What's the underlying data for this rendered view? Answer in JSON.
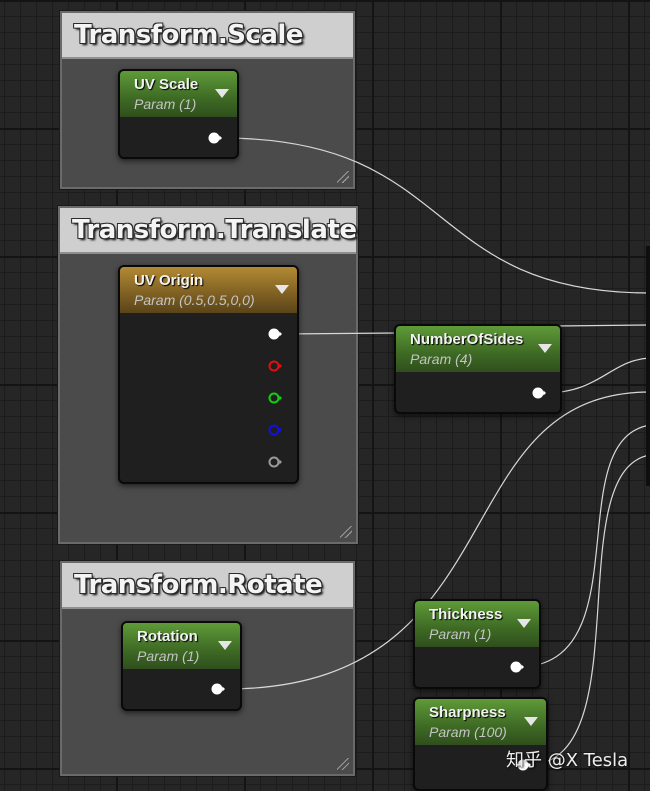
{
  "comments": [
    {
      "id": "scale",
      "title": "Transform.Scale"
    },
    {
      "id": "translate",
      "title": "Transform.Translate"
    },
    {
      "id": "rotate",
      "title": "Transform.Rotate"
    }
  ],
  "nodes": {
    "uv_scale": {
      "title": "UV Scale",
      "subtitle": "Param (1)",
      "color": "#5a9434"
    },
    "uv_origin": {
      "title": "UV Origin",
      "subtitle": "Param (0.5,0.5,0,0)",
      "color": "#a8822f"
    },
    "number_of_sides": {
      "title": "NumberOfSides",
      "subtitle": "Param (4)",
      "color": "#5a9434"
    },
    "rotation": {
      "title": "Rotation",
      "subtitle": "Param (1)",
      "color": "#5a9434"
    },
    "thickness": {
      "title": "Thickness",
      "subtitle": "Param (1)",
      "color": "#5a9434"
    },
    "sharpness": {
      "title": "Sharpness",
      "subtitle": "Param (100)",
      "color": "#5a9434"
    }
  },
  "pin_colors": {
    "white": "#ffffff",
    "red": "#e01010",
    "green": "#10d010",
    "blue": "#1010e0",
    "gray": "#9a9a9a"
  },
  "watermark": "知乎 @X Tesla"
}
